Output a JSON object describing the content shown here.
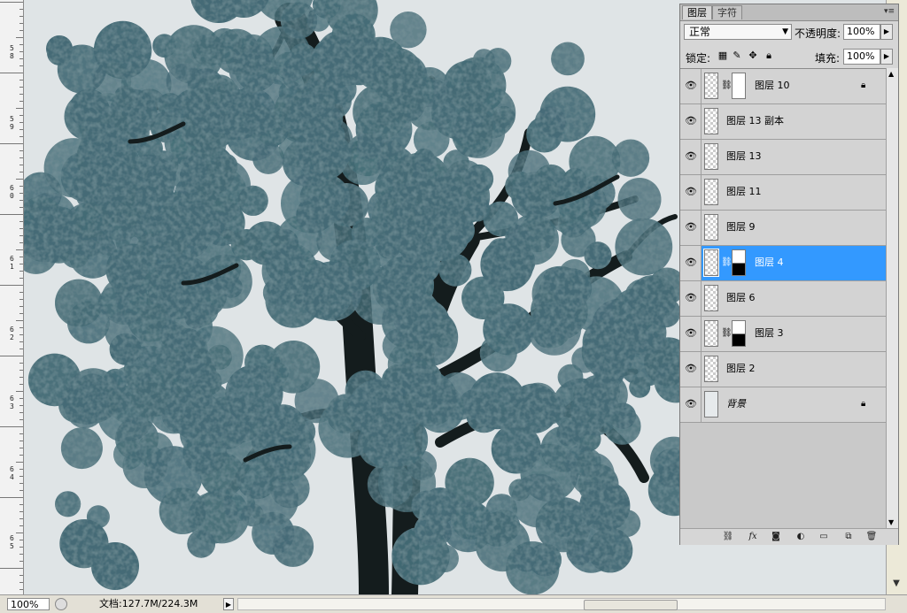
{
  "ruler": {
    "labels": [
      "5\n8",
      "5\n9",
      "6\n0",
      "6\n1",
      "6\n2",
      "6\n3",
      "6\n4",
      "6\n5"
    ]
  },
  "status": {
    "zoom": "100%",
    "doc_info": "文档:127.7M/224.3M"
  },
  "panel": {
    "tabs": [
      "图层",
      "字符"
    ],
    "blend_mode": "正常",
    "opacity_label": "不透明度:",
    "opacity_value": "100%",
    "lock_label": "锁定:",
    "fill_label": "填充:",
    "fill_value": "100%",
    "layers": [
      {
        "name": "图层 10",
        "visible": true,
        "mask": "white",
        "locked": true,
        "selected": false
      },
      {
        "name": "图层 13 副本",
        "visible": true,
        "mask": null,
        "locked": false,
        "selected": false
      },
      {
        "name": "图层 13",
        "visible": true,
        "mask": null,
        "locked": false,
        "selected": false
      },
      {
        "name": "图层 11",
        "visible": true,
        "mask": null,
        "locked": false,
        "selected": false
      },
      {
        "name": "图层 9",
        "visible": true,
        "mask": null,
        "locked": false,
        "selected": false
      },
      {
        "name": "图层 4",
        "visible": true,
        "mask": "half",
        "locked": false,
        "selected": true
      },
      {
        "name": "图层 6",
        "visible": true,
        "mask": null,
        "locked": false,
        "selected": false
      },
      {
        "name": "图层 3",
        "visible": true,
        "mask": "half",
        "locked": false,
        "selected": false
      },
      {
        "name": "图层 2",
        "visible": true,
        "mask": null,
        "locked": false,
        "selected": false
      },
      {
        "name": "背景",
        "visible": true,
        "mask": null,
        "locked": true,
        "selected": false,
        "background": true
      }
    ]
  },
  "colors": {
    "selection": "#3399ff",
    "foliage": "#456b76",
    "trunk": "#141c1d",
    "canvas": "#dfe4e6"
  }
}
